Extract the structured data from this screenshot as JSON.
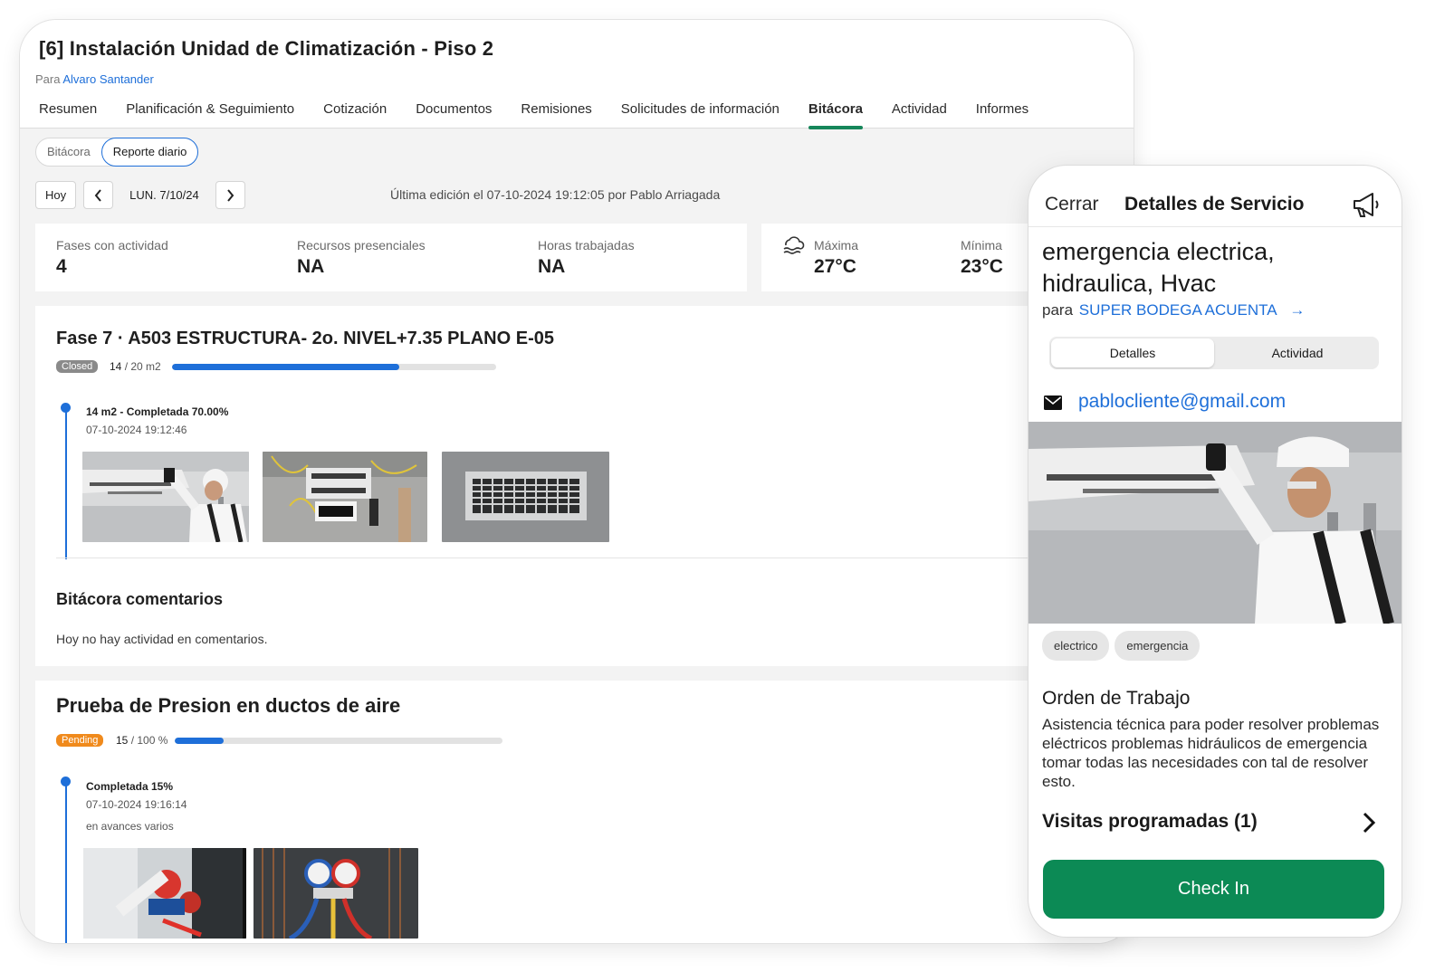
{
  "project": {
    "title": "[6] Instalación Unidad de Climatización - Piso 2",
    "owner_prefix": "Para",
    "owner_name": "Alvaro Santander"
  },
  "tabs": [
    {
      "label": "Resumen"
    },
    {
      "label": "Planificación & Seguimiento"
    },
    {
      "label": "Cotización"
    },
    {
      "label": "Documentos"
    },
    {
      "label": "Remisiones"
    },
    {
      "label": "Solicitudes de información"
    },
    {
      "label": "Bitácora",
      "active": true
    },
    {
      "label": "Actividad"
    },
    {
      "label": "Informes"
    }
  ],
  "view_toggle": {
    "left": "Bitácora",
    "right": "Reporte diario",
    "selected": "Reporte diario"
  },
  "date_nav": {
    "today": "Hoy",
    "date": "LUN. 7/10/24"
  },
  "last_edit": "Última edición el 07-10-2024 19:12:05 por Pablo Arriagada",
  "stats": [
    {
      "label": "Fases con actividad",
      "value": "4"
    },
    {
      "label": "Recursos presenciales",
      "value": "NA"
    },
    {
      "label": "Horas trabajadas",
      "value": "NA"
    }
  ],
  "weather": {
    "icon": "weather-icon",
    "max_label": "Máxima",
    "max_value": "27°C",
    "min_label": "Mínima",
    "min_value": "23°C"
  },
  "phase1": {
    "title": "Fase 7 · A503 ESTRUCTURA- 2o. NIVEL+7.35 PLANO E-05",
    "badge": "Closed",
    "qty_done": "14",
    "qty_total": "/ 20 m2",
    "progress": 0.7,
    "entry_title": "14 m2 - Completada 70.00%",
    "entry_date": "07-10-2024 19:12:46"
  },
  "comments": {
    "title": "Bitácora comentarios",
    "empty": "Hoy no hay actividad en comentarios."
  },
  "phase2": {
    "title": "Prueba de Presion en ductos de aire",
    "badge": "Pending",
    "qty_done": "15",
    "qty_total": "/ 100 %",
    "progress": 0.15,
    "entry_title": "Completada 15%",
    "entry_date": "07-10-2024 19:16:14",
    "entry_note": "en avances varios"
  },
  "service": {
    "close": "Cerrar",
    "header": "Detalles de Servicio",
    "title": "emergencia electrica, hidraulica, Hvac",
    "client_prefix": "para",
    "client": "SUPER BODEGA ACUENTA",
    "tabs": {
      "left": "Detalles",
      "right": "Actividad",
      "selected": "Detalles"
    },
    "email": "pablocliente@gmail.com",
    "tags": [
      "electrico",
      "emergencia"
    ],
    "order_title": "Orden de Trabajo",
    "order_text": "Asistencia técnica para poder resolver problemas eléctricos problemas hidráulicos de emergencia tomar todas las necesidades con tal de resolver esto.",
    "visits": "Visitas programadas (1)",
    "checkin": "Check In"
  },
  "colors": {
    "accent_green": "#16865a",
    "button_green": "#0c8a55",
    "link_blue": "#1e6fd9",
    "closed_grey": "#8a8a8a",
    "pending_orange": "#f08a1c"
  }
}
